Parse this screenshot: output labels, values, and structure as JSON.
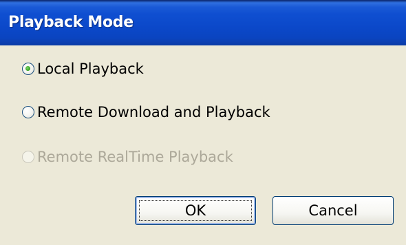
{
  "window": {
    "title": "Playback Mode"
  },
  "options": [
    {
      "label": "Local Playback",
      "checked": true,
      "enabled": true
    },
    {
      "label": "Remote Download and Playback",
      "checked": false,
      "enabled": true
    },
    {
      "label": "Remote RealTime Playback",
      "checked": false,
      "enabled": false
    }
  ],
  "buttons": {
    "ok_label": "OK",
    "cancel_label": "Cancel"
  },
  "colors": {
    "titlebar": "#0a44c0",
    "dialog_background": "#ece9d8",
    "disabled_text": "#aca899",
    "radio_selected": "#2fa01a"
  }
}
